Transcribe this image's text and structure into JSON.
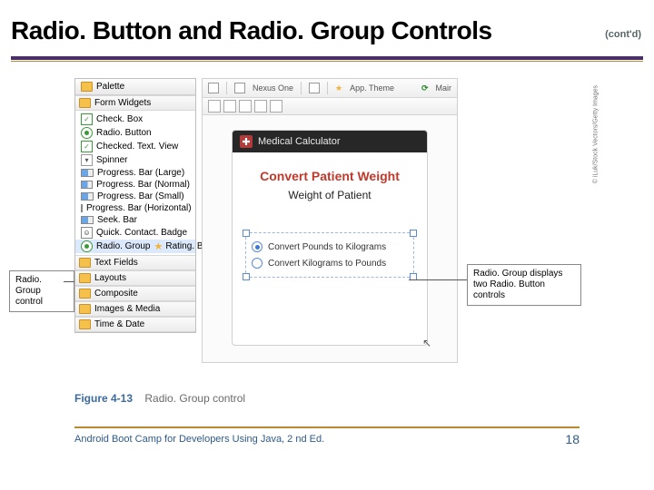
{
  "title": "Radio. Button and Radio. Group Controls",
  "contd": "(cont'd)",
  "palette": {
    "header": "Palette",
    "formWidgets": "Form Widgets",
    "items": {
      "checkbox": "Check. Box",
      "radiobutton": "Radio. Button",
      "checkedtv": "Checked. Text. View",
      "spinner": "Spinner",
      "pbLarge": "Progress. Bar (Large)",
      "pbNormal": "Progress. Bar (Normal)",
      "pbSmall": "Progress. Bar (Small)",
      "pbHoriz": "Progress. Bar (Horizontal)",
      "seekbar": "Seek. Bar",
      "qcb": "Quick. Contact. Badge",
      "radiogroup": "Radio. Group",
      "ratingbar": "Rating. Bar"
    },
    "cats": {
      "textfields": "Text Fields",
      "layouts": "Layouts",
      "composite": "Composite",
      "images": "Images & Media",
      "time": "Time & Date"
    }
  },
  "devicebar": {
    "device": "Nexus One",
    "theme": "App. Theme",
    "mair": "Mair"
  },
  "phone": {
    "appTitle": "Medical Calculator",
    "h1": "Convert Patient Weight",
    "h2": "Weight of Patient",
    "rb1": "Convert Pounds to Kilograms",
    "rb2": "Convert Kilograms to Pounds"
  },
  "callouts": {
    "left": "Radio. Group control",
    "right": "Radio. Group displays two Radio. Button controls"
  },
  "credit": "© iLuk/Stock Vectors/Getty Images",
  "figure": {
    "num": "Figure 4-13",
    "caption": "Radio. Group control"
  },
  "footer": {
    "left": "Android Boot Camp for Developers Using Java, 2 nd Ed.",
    "page": "18"
  }
}
